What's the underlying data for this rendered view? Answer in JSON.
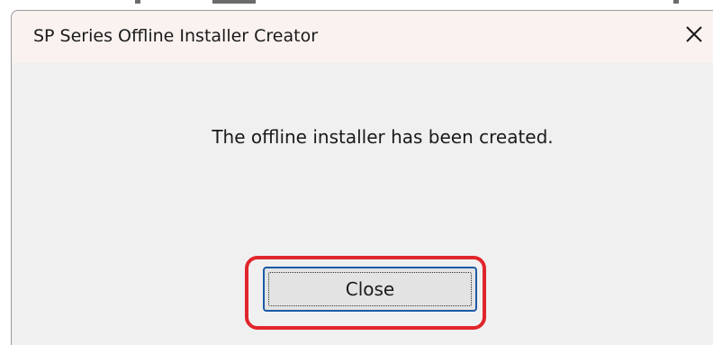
{
  "dialog": {
    "title": "SP Series Offline Installer Creator",
    "close_icon": "close-icon",
    "message": "The offline installer has been created.",
    "close_button_label": "Close"
  },
  "colors": {
    "titlebar_bg": "#f9f2ef",
    "dialog_bg": "#f0f0f0",
    "button_border": "#1a5aa6",
    "highlight": "#e0252b"
  }
}
